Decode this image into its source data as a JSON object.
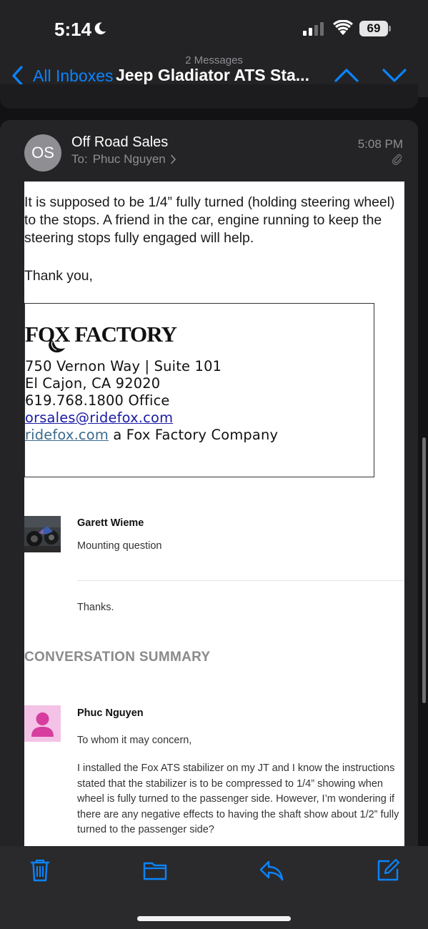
{
  "status_bar": {
    "time": "5:14",
    "battery": "69",
    "icons": [
      "moon-icon",
      "cellular-signal-icon",
      "wifi-icon",
      "battery-icon"
    ]
  },
  "nav": {
    "message_count": "2 Messages",
    "back_label": "All Inboxes",
    "title": "Jeep Gladiator ATS Sta...",
    "accent_color": "#0a84ff"
  },
  "message": {
    "avatar_initials": "OS",
    "sender": "Off Road Sales",
    "to_label": "To:",
    "to_name": "Phuc Nguyen",
    "time": "5:08 PM",
    "body": {
      "line1": "It is supposed to be 1/4” fully turned (holding steering wheel)",
      "line2": "to the stops. A friend in the car, engine running to keep the",
      "line3": "steering stops fully engaged will help.",
      "closing": "Thank you,"
    },
    "signature": {
      "logo_text": "FOX FACTORY",
      "address1": "750 Vernon Way | Suite 101",
      "address2": "El Cajon, CA 92020",
      "phone_number": "619.768.1800",
      "phone_label": " Office",
      "email": "orsales@ridefox.com",
      "website": "ridefox.com",
      "website_suffix": " a Fox Factory Company"
    },
    "quoted": {
      "name": "Garett Wieme",
      "subject": "Mounting question",
      "thanks": "Thanks."
    },
    "summary_heading": "CONVERSATION SUMMARY",
    "original": {
      "name": "Phuc Nguyen",
      "greeting": "To whom it may concern,",
      "body": "I installed the Fox ATS stabilizer on my JT and I know the instructions stated that the stabilizer is to be compressed to 1/4” showing when wheel is fully turned to the passenger side. However, I’m wondering if there are any negative effects to having the shaft show about 1/2” fully turned to the passenger side?"
    }
  },
  "toolbar": {
    "buttons": [
      "trash-icon",
      "folder-icon",
      "reply-icon",
      "compose-icon"
    ]
  }
}
